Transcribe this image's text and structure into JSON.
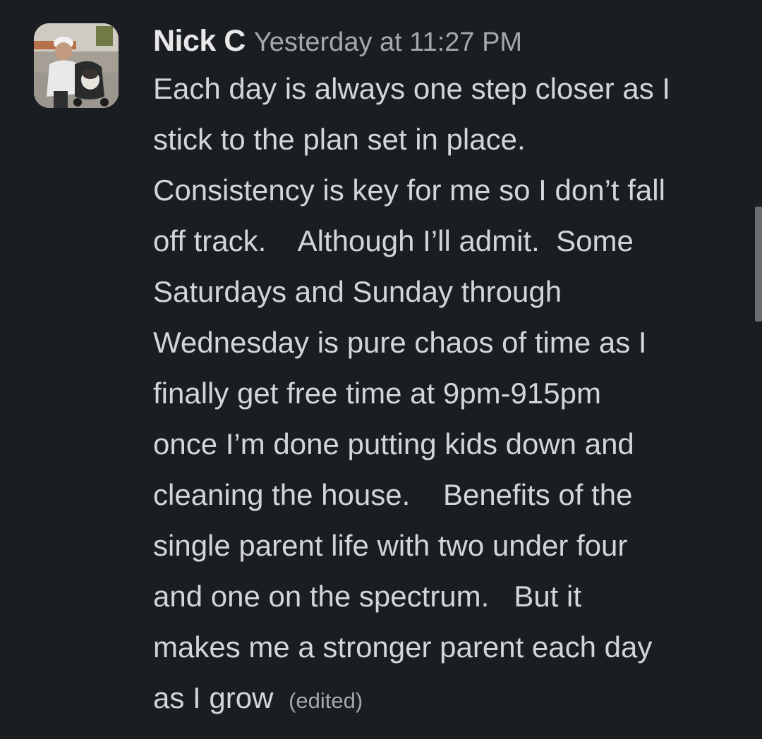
{
  "message": {
    "author": "Nick C",
    "timestamp": "Yesterday at 11:27 PM",
    "lines": [
      "Each day is always one step closer as I",
      "stick to the plan set in place.",
      "Consistency is key for me so I don’t fall",
      "off track.    Although I’ll admit.  Some",
      "Saturdays and Sunday through",
      "Wednesday is pure chaos of time as I",
      "finally get free time at 9pm-915pm",
      "once I’m done putting kids down and",
      "cleaning the house.    Benefits of the",
      "single parent life with two under four",
      "and one on the spectrum.   But it",
      "makes me a stronger parent each day",
      "as I grow "
    ],
    "edited_label": "(edited)"
  },
  "colors": {
    "background": "#1a1d21",
    "text": "#d4d5d6",
    "author": "#e8e8e8",
    "muted": "#a6a8aa"
  }
}
